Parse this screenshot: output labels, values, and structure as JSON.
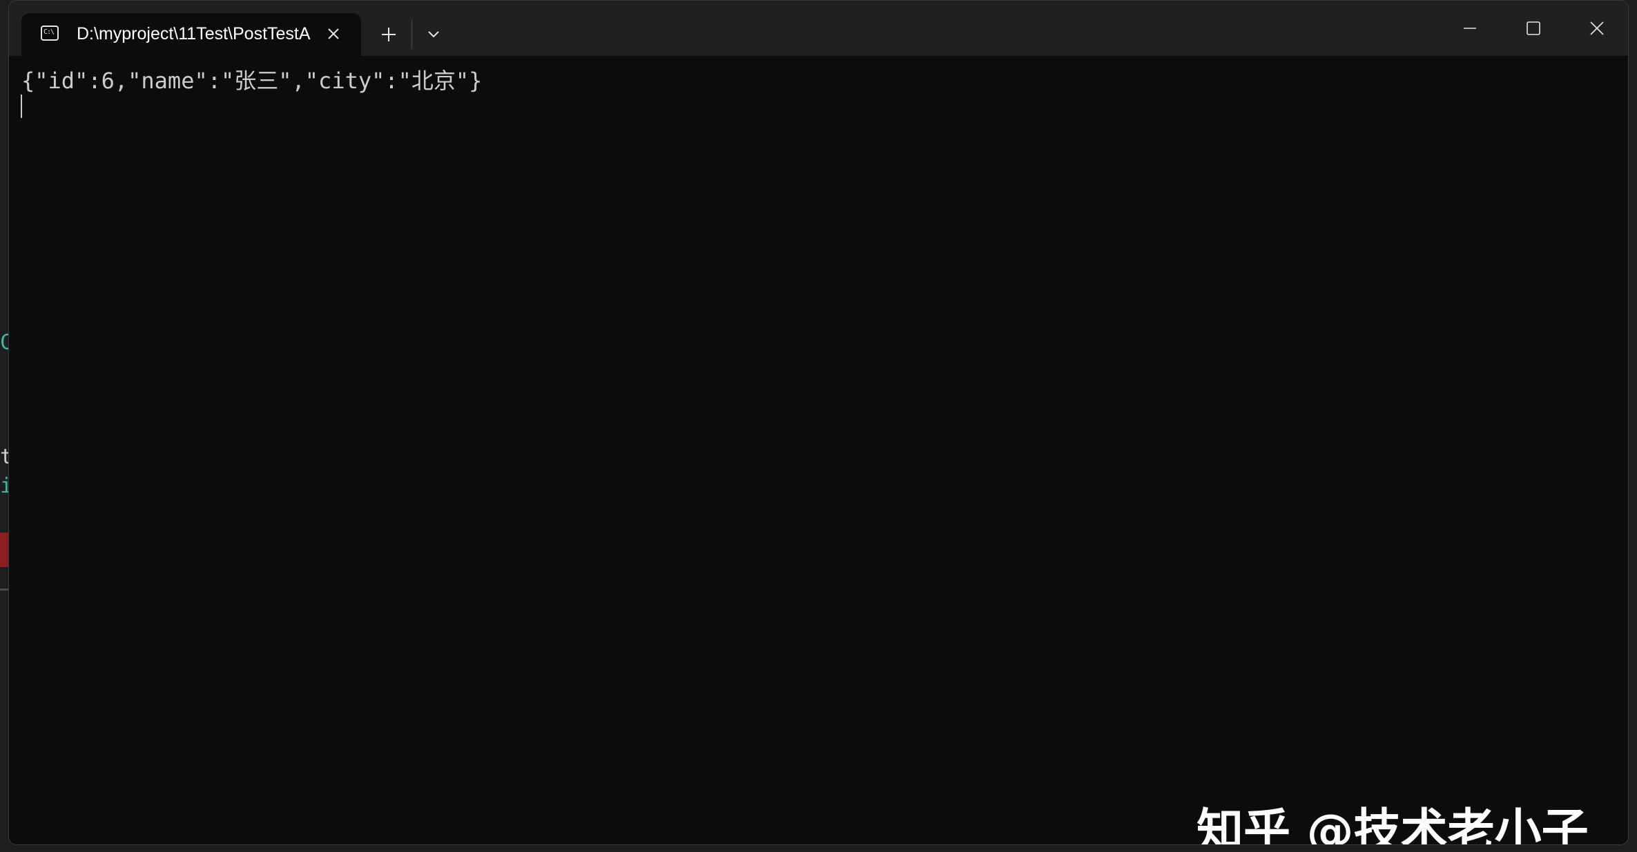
{
  "tab": {
    "title": "D:\\myproject\\11Test\\PostTestA",
    "icon": "command-prompt-icon",
    "icon_text": "C:\\"
  },
  "toolbar": {
    "new_tab": "+",
    "dropdown": "chevron-down-icon"
  },
  "window_controls": {
    "minimize": "minimize-icon",
    "maximize": "maximize-icon",
    "close": "close-icon"
  },
  "terminal": {
    "output": "{\"id\":6,\"name\":\"张三\",\"city\":\"北京\"}"
  },
  "watermark": {
    "text": "知乎 @技术老小子"
  },
  "colors": {
    "terminal_bg": "#0c0c0c",
    "titlebar_bg": "#202020",
    "text": "#cccccc"
  }
}
